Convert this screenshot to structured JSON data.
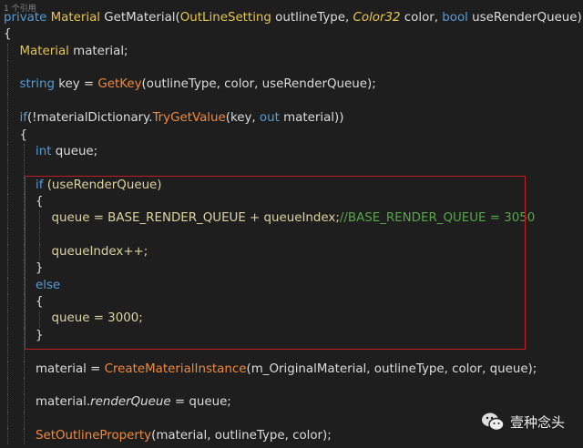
{
  "codelens": "1 个引用",
  "colors": {
    "background": "#1e1e1e",
    "keyword": "#569cd6",
    "type": "#e6c64c",
    "method": "#f08a3c",
    "comment": "#57a64a",
    "highlight_box": "#c01e1e"
  },
  "lines": [
    {
      "indent": 0,
      "tokens": [
        [
          "kw",
          "private "
        ],
        [
          "type",
          "Material "
        ],
        [
          "",
          "GetMaterial("
        ],
        [
          "type",
          "OutLineSetting "
        ],
        [
          "",
          "outlineType, "
        ],
        [
          "typeital",
          "Color32 "
        ],
        [
          "",
          "color, "
        ],
        [
          "kw",
          "bool "
        ],
        [
          "",
          "useRenderQueue)"
        ]
      ]
    },
    {
      "indent": 0,
      "tokens": [
        [
          "",
          "{"
        ]
      ]
    },
    {
      "indent": 1,
      "tokens": [
        [
          "type",
          "Material "
        ],
        [
          "",
          "material;"
        ]
      ]
    },
    {
      "indent": 1,
      "tokens": []
    },
    {
      "indent": 1,
      "tokens": [
        [
          "kw",
          "string "
        ],
        [
          "",
          "key = "
        ],
        [
          "method",
          "GetKey"
        ],
        [
          "",
          "(outlineType, color, useRenderQueue);"
        ]
      ]
    },
    {
      "indent": 1,
      "tokens": []
    },
    {
      "indent": 1,
      "tokens": [
        [
          "kw",
          "if"
        ],
        [
          "",
          "(!materialDictionary."
        ],
        [
          "method",
          "TryGetValue"
        ],
        [
          "",
          "(key, "
        ],
        [
          "kw",
          "out "
        ],
        [
          "",
          "material))"
        ]
      ]
    },
    {
      "indent": 1,
      "tokens": [
        [
          "",
          "{"
        ]
      ]
    },
    {
      "indent": 2,
      "tokens": [
        [
          "kw",
          "int "
        ],
        [
          "",
          "queue;"
        ]
      ]
    },
    {
      "indent": 2,
      "tokens": []
    },
    {
      "indent": 2,
      "tokens": [
        [
          "kw",
          "if "
        ],
        [
          "local",
          "(useRenderQueue)"
        ]
      ]
    },
    {
      "indent": 2,
      "tokens": [
        [
          "",
          "{"
        ]
      ]
    },
    {
      "indent": 3,
      "tokens": [
        [
          "local",
          "queue = BASE_RENDER_QUEUE + queueIndex;"
        ],
        [
          "cm",
          "//BASE_RENDER_QUEUE = 3050"
        ]
      ]
    },
    {
      "indent": 3,
      "tokens": []
    },
    {
      "indent": 3,
      "tokens": [
        [
          "local",
          "queueIndex++;"
        ]
      ]
    },
    {
      "indent": 2,
      "tokens": [
        [
          "",
          "}"
        ]
      ]
    },
    {
      "indent": 2,
      "tokens": [
        [
          "kw",
          "else"
        ]
      ]
    },
    {
      "indent": 2,
      "tokens": [
        [
          "",
          "{"
        ]
      ]
    },
    {
      "indent": 3,
      "tokens": [
        [
          "local",
          "queue = 3000;"
        ]
      ]
    },
    {
      "indent": 2,
      "tokens": [
        [
          "",
          "}"
        ]
      ]
    },
    {
      "indent": 2,
      "tokens": []
    },
    {
      "indent": 2,
      "tokens": [
        [
          "",
          "material = "
        ],
        [
          "method",
          "CreateMaterialInstance"
        ],
        [
          "",
          "(m_OriginalMaterial, outlineType, color, queue);"
        ]
      ]
    },
    {
      "indent": 2,
      "tokens": []
    },
    {
      "indent": 2,
      "tokens": [
        [
          "",
          "material."
        ],
        [
          "ital",
          "renderQueue"
        ],
        [
          "",
          " = queue;"
        ]
      ]
    },
    {
      "indent": 2,
      "tokens": []
    },
    {
      "indent": 2,
      "tokens": [
        [
          "method",
          "SetOutlineProperty"
        ],
        [
          "",
          "(material, outlineType, color);"
        ]
      ]
    }
  ],
  "watermark": {
    "icon": "wechat-icon",
    "text": "壹种念头"
  }
}
